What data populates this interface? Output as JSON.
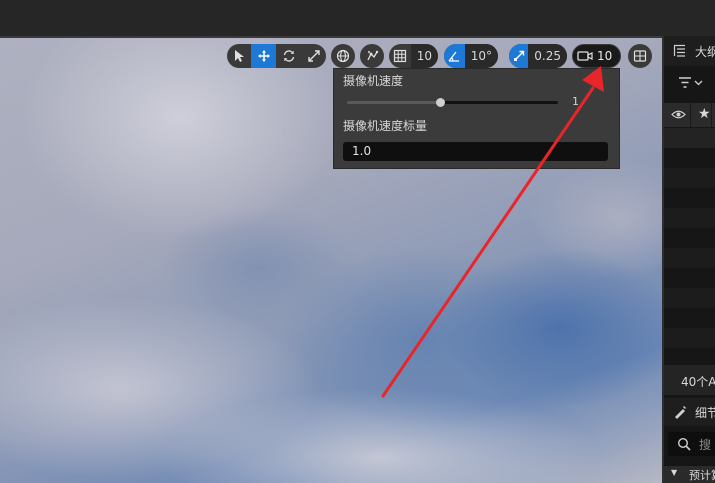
{
  "toolbar": {
    "grid_snap_value": "10",
    "rotation_snap_value": "10°",
    "scale_snap_value": "0.25",
    "camera_speed_value": "10"
  },
  "camera_popup": {
    "speed_label": "摄像机速度",
    "speed_value": "1",
    "speed_slider_level": 0.44,
    "scalar_label": "摄像机速度标量",
    "scalar_value": "1.0"
  },
  "right_panel": {
    "outliner_title": "大纲",
    "actor_count": "40个A",
    "details_title": "细节",
    "search_placeholder": "搜",
    "section_label": "预计算"
  },
  "colors": {
    "accent": "#1e78d6",
    "annotation_arrow": "#e8262a"
  }
}
